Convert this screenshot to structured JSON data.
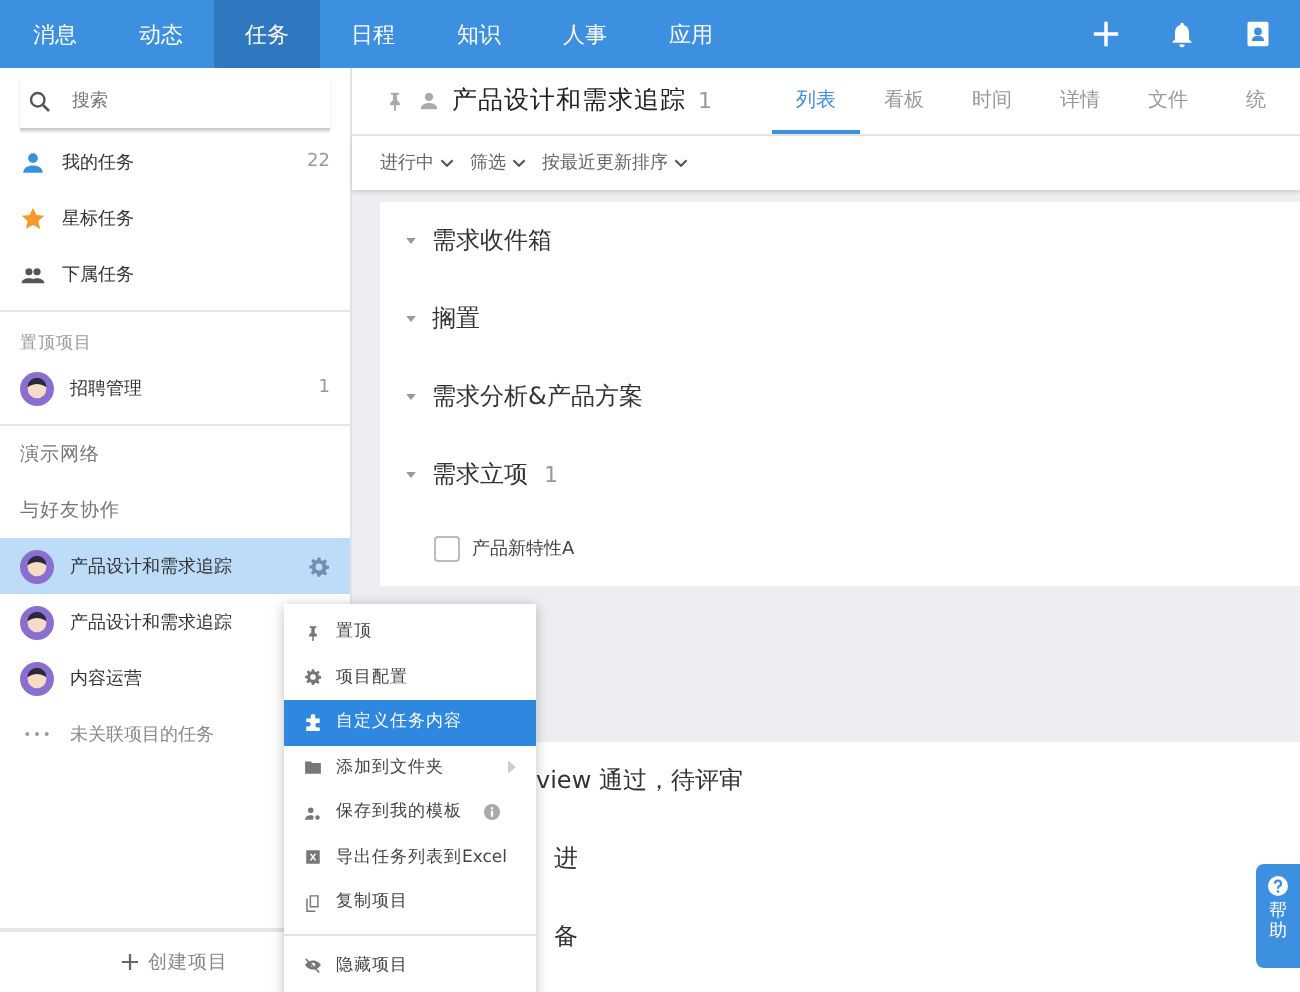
{
  "top_nav": {
    "items": [
      {
        "label": "消息",
        "selected": false
      },
      {
        "label": "动态",
        "selected": false
      },
      {
        "label": "任务",
        "selected": true
      },
      {
        "label": "日程",
        "selected": false
      },
      {
        "label": "知识",
        "selected": false
      },
      {
        "label": "人事",
        "selected": false
      },
      {
        "label": "应用",
        "selected": false
      }
    ]
  },
  "sidebar": {
    "search": {
      "placeholder": "搜索"
    },
    "nav_items": [
      {
        "kind": "person",
        "label": "我的任务",
        "count": "22"
      },
      {
        "kind": "star",
        "label": "星标任务"
      },
      {
        "kind": "people",
        "label": "下属任务"
      }
    ],
    "pinned_heading": "置顶项目",
    "pinned": [
      {
        "name": "招聘管理",
        "count": "1"
      }
    ],
    "groups": [
      "演示网络",
      "与好友协作"
    ],
    "projects": [
      {
        "name": "产品设计和需求追踪",
        "selected": true
      },
      {
        "name": "产品设计和需求追踪",
        "selected": false
      },
      {
        "name": "内容运营",
        "selected": false
      }
    ],
    "unlinked": "未关联项目的任务",
    "create_button": "创建项目"
  },
  "header": {
    "title": "产品设计和需求追踪",
    "count": "1",
    "tabs": [
      {
        "label": "列表",
        "selected": true
      },
      {
        "label": "看板",
        "selected": false
      },
      {
        "label": "时间",
        "selected": false
      },
      {
        "label": "详情",
        "selected": false
      },
      {
        "label": "文件",
        "selected": false
      },
      {
        "label": "统",
        "selected": false
      }
    ]
  },
  "filters": [
    "进行中",
    "筛选",
    "按最近更新排序"
  ],
  "sections": [
    {
      "title": "需求收件箱"
    },
    {
      "title": "搁置"
    },
    {
      "title": "需求分析&产品方案"
    },
    {
      "title": "需求立项",
      "count": "1",
      "tasks": [
        {
          "title": "产品新特性A",
          "checked": false
        }
      ]
    }
  ],
  "lower_sections": [
    "view 通过，待评审",
    "进",
    "备"
  ],
  "context_menu": {
    "items": [
      {
        "kind": "pin",
        "label": "置顶",
        "selected": false
      },
      {
        "kind": "gear",
        "label": "项目配置",
        "selected": false
      },
      {
        "kind": "puzzle",
        "label": "自定义任务内容",
        "selected": true
      },
      {
        "kind": "folder",
        "label": "添加到文件夹",
        "selected": false,
        "submenu": true
      },
      {
        "kind": "template",
        "label": "保存到我的模板",
        "selected": false,
        "info": true
      },
      {
        "kind": "excel",
        "label": "导出任务列表到Excel",
        "selected": false
      },
      {
        "kind": "copy",
        "label": "复制项目",
        "selected": false
      },
      {
        "kind": "hide",
        "label": "隐藏项目",
        "selected": false,
        "divider_before": true
      }
    ]
  },
  "help_button": {
    "label": "帮助"
  }
}
